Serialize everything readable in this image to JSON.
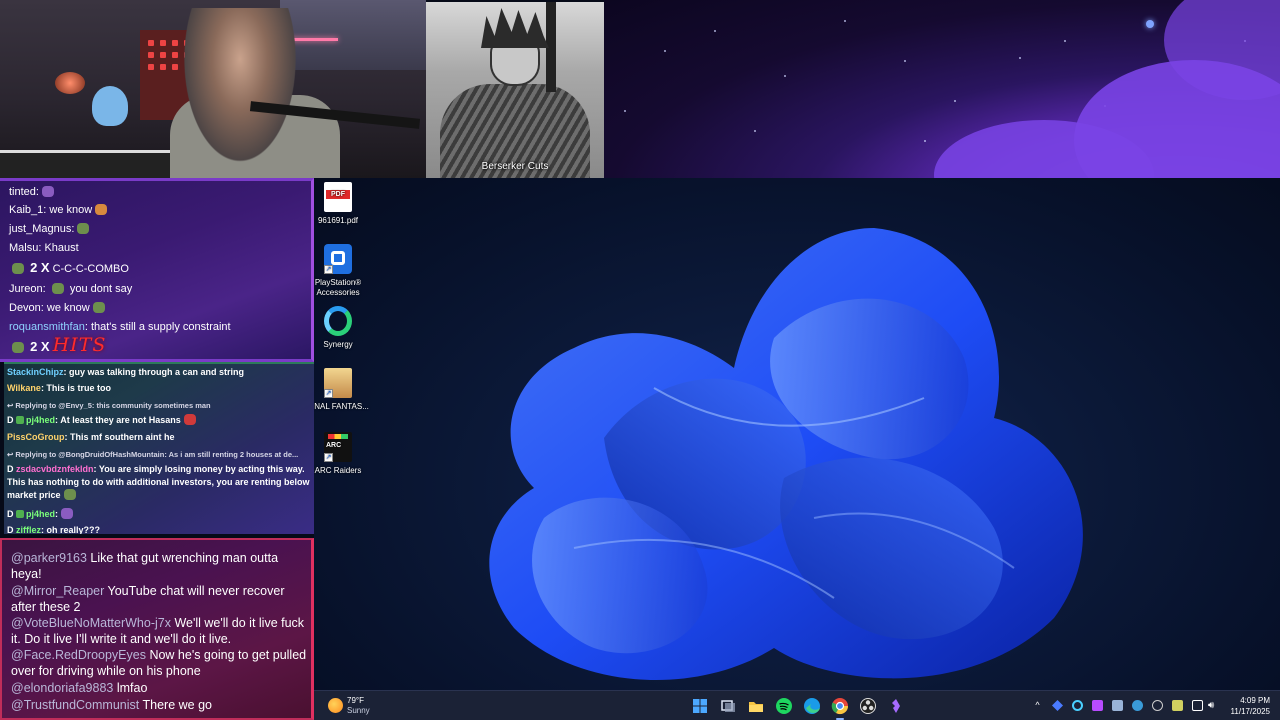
{
  "overlay": {
    "berserk_caption": "Berserker Cuts"
  },
  "desktop_icons": [
    {
      "label": "961691.pdf",
      "icon": "pdf-file-icon"
    },
    {
      "label": "PlayStation® Accessories",
      "icon": "playstation-accessories-icon"
    },
    {
      "label": "Synergy",
      "icon": "synergy-icon"
    },
    {
      "label": "FINAL FANTAS...",
      "icon": "final-fantasy-icon"
    },
    {
      "label": "ARC Raiders",
      "icon": "arc-raiders-icon"
    }
  ],
  "chat_top": {
    "lines": [
      {
        "user": "tinted:",
        "text": ""
      },
      {
        "user": "Kaib_1:",
        "text": "we know"
      },
      {
        "user": "just_Magnus:",
        "text": ""
      },
      {
        "user": "Malsu:",
        "text": "Khaust"
      },
      {
        "combo_mult": "2 X",
        "combo_text": "C-C-C-COMBO"
      },
      {
        "user": "Jureon:",
        "text": "you dont say"
      },
      {
        "user": "Devon:",
        "text": "we know"
      },
      {
        "user": "roquansmithfan",
        "text": ": that's still a supply constraint"
      },
      {
        "combo_mult": "2 X",
        "combo_text": "HITS"
      }
    ]
  },
  "chat_mid": {
    "lines": [
      {
        "user": "StackinChipz",
        "text": ": guy was talking through a can and string"
      },
      {
        "user": "Wilkane",
        "text": ": This is true too"
      },
      {
        "reply": "↩ Replying to @Envy_5: this community sometimes man"
      },
      {
        "prefix": "D",
        "user": "pj4hed",
        "text": ": At least they are not Hasans"
      },
      {
        "user": "PissCoGroup",
        "text": ": This mf southern aint he"
      },
      {
        "reply": "↩ Replying to @BongDruidOfHashMountain: As i am still renting 2 houses at de..."
      },
      {
        "prefix": "D",
        "user": "zsdacvbdznfekldn",
        "text": ": You are simply losing money by acting this way. This has nothing to do with additional investors, you are renting below market price"
      },
      {
        "prefix": "D",
        "user": "pj4hed",
        "text": ":"
      },
      {
        "prefix": "D",
        "user": "zifflez",
        "text": ": oh really???"
      }
    ]
  },
  "chat_bottom": {
    "messages": [
      {
        "user": "@parker9163",
        "text": " Like that gut wrenching man outta heya!"
      },
      {
        "user": "@Mirror_Reaper",
        "text": " YouTube chat will never recover after these 2"
      },
      {
        "user": "@VoteBlueNoMatterWho-j7x",
        "text": " We'll we'll do it live fuck it. Do it live I'll write it and we'll do it live."
      },
      {
        "user": "@Face.RedDroopyEyes",
        "text": " Now he's going to get pulled over for driving while on his phone"
      },
      {
        "user": "@elondoriafa9883",
        "text": " lmfao"
      },
      {
        "user": "@TrustfundCommunist",
        "text": " There we go"
      }
    ]
  },
  "taskbar": {
    "weather_temp": "79°F",
    "weather_desc": "Sunny",
    "apps": [
      "start-icon",
      "task-view-icon",
      "file-explorer-icon",
      "spotify-icon",
      "edge-icon",
      "chrome-icon",
      "obs-icon",
      "app-icon"
    ],
    "time": "4:09 PM",
    "date": "11/17/2025"
  },
  "colors": {
    "taskbar_bg": "#1b2236",
    "chat_top_border": "#a04fe0",
    "chat_bottom_border": "#e03060",
    "accent_blue": "#1f4fff"
  }
}
